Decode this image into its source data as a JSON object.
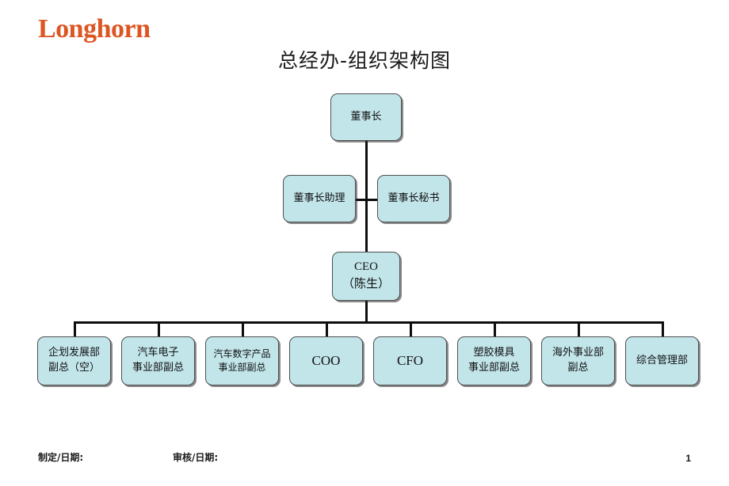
{
  "brand": {
    "logo_text": "Longhorn",
    "logo_color": "#dd5522"
  },
  "page_title": "总经办-组织架构图",
  "theme": {
    "node_fill": "#c2e5ea",
    "node_border": "#4e4e4e",
    "connector": "#0d0d0d",
    "text": "#111111"
  },
  "chart_data": {
    "type": "diagram",
    "diagram_kind": "org-chart",
    "title": "总经办-组织架构图",
    "nodes": [
      {
        "id": "chairman",
        "label": "董事长",
        "level": 0
      },
      {
        "id": "assistant",
        "label": "董事长助理",
        "level": 1
      },
      {
        "id": "secretary",
        "label": "董事长秘书",
        "level": 1
      },
      {
        "id": "ceo",
        "label": "CEO\n（陈生）",
        "level": 2
      },
      {
        "id": "dept1",
        "label": "企划发展部\n副总（空）",
        "level": 3
      },
      {
        "id": "dept2",
        "label": "汽车电子\n事业部副总",
        "level": 3
      },
      {
        "id": "dept3",
        "label": "汽车数字产品\n事业部副总",
        "level": 3
      },
      {
        "id": "dept4",
        "label": "COO",
        "level": 3
      },
      {
        "id": "dept5",
        "label": "CFO",
        "level": 3
      },
      {
        "id": "dept6",
        "label": "塑胶模具\n事业部副总",
        "level": 3
      },
      {
        "id": "dept7",
        "label": "海外事业部\n副总",
        "level": 3
      },
      {
        "id": "dept8",
        "label": "综合管理部",
        "level": 3
      }
    ],
    "edges": [
      {
        "from": "chairman",
        "to": "ceo"
      },
      {
        "from": "chairman",
        "to": "assistant"
      },
      {
        "from": "chairman",
        "to": "secretary"
      },
      {
        "from": "ceo",
        "to": "dept1"
      },
      {
        "from": "ceo",
        "to": "dept2"
      },
      {
        "from": "ceo",
        "to": "dept3"
      },
      {
        "from": "ceo",
        "to": "dept4"
      },
      {
        "from": "ceo",
        "to": "dept5"
      },
      {
        "from": "ceo",
        "to": "dept6"
      },
      {
        "from": "ceo",
        "to": "dept7"
      },
      {
        "from": "ceo",
        "to": "dept8"
      }
    ]
  },
  "footer": {
    "made_label": "制定/日期:",
    "check_label": "审核/日期:",
    "page_number": "1"
  }
}
